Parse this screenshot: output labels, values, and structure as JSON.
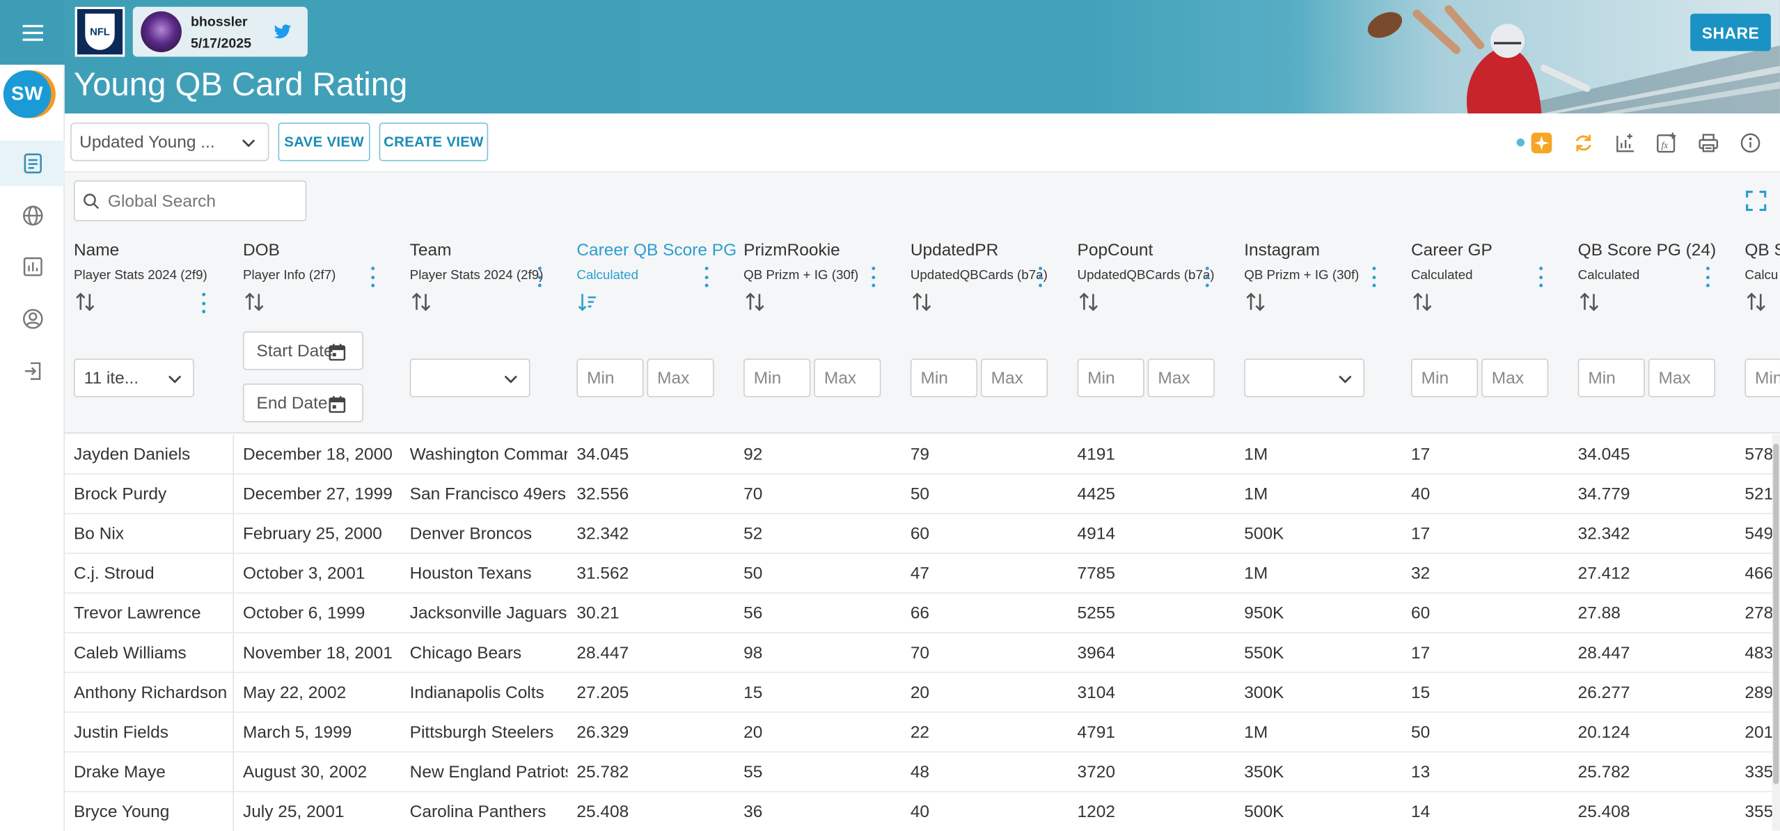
{
  "header": {
    "user_name": "bhossler",
    "user_date": "5/17/2025",
    "page_title": "Young QB Card Rating",
    "share_label": "SHARE",
    "brand_logo": "NFL",
    "app_logo": "SW"
  },
  "toolbar": {
    "view_select_value": "Updated Young ...",
    "save_view_label": "SAVE VIEW",
    "create_view_label": "CREATE VIEW",
    "icons": [
      "sparkle-icon",
      "refresh-icon",
      "add-chart-icon",
      "add-formula-icon",
      "print-icon",
      "info-icon"
    ]
  },
  "search": {
    "placeholder": "Global Search"
  },
  "nav": {
    "icons": [
      "menu-icon",
      "report-icon",
      "globe-icon",
      "bar-chart-icon",
      "user-icon",
      "login-icon"
    ]
  },
  "colors": {
    "header_teal": "#3f9fb7",
    "accent_blue": "#2b9ed0",
    "share_blue": "#1a93c4",
    "logo_orange": "#f59b23"
  },
  "columns": [
    {
      "title": "Name",
      "source": "Player Stats 2024 (2f9)"
    },
    {
      "title": "DOB",
      "source": "Player Info (2f7)"
    },
    {
      "title": "Team",
      "source": "Player Stats 2024 (2f9)"
    },
    {
      "title": "Career QB Score PG",
      "source": "Calculated"
    },
    {
      "title": "PrizmRookie",
      "source": "QB Prizm + IG (30f)"
    },
    {
      "title": "UpdatedPR",
      "source": "UpdatedQBCards (b7a)"
    },
    {
      "title": "PopCount",
      "source": "UpdatedQBCards (b7a)"
    },
    {
      "title": "Instagram",
      "source": "QB Prizm + IG (30f)"
    },
    {
      "title": "Career GP",
      "source": "Calculated"
    },
    {
      "title": "QB Score PG (24)",
      "source": "Calculated"
    },
    {
      "title": "QB S",
      "source": "Calcu"
    }
  ],
  "filters": {
    "name_select": "11 ite...",
    "start_date": "Start Date",
    "end_date": "End Date",
    "min": "Min",
    "max": "Max"
  },
  "rows": [
    [
      "Jayden Daniels",
      "December 18, 2000",
      "Washington Comman",
      "34.045",
      "92",
      "79",
      "4191",
      "1M",
      "17",
      "34.045",
      "578"
    ],
    [
      "Brock Purdy",
      "December 27, 1999",
      "San Francisco 49ers",
      "32.556",
      "70",
      "50",
      "4425",
      "1M",
      "40",
      "34.779",
      "521"
    ],
    [
      "Bo Nix",
      "February 25, 2000",
      "Denver Broncos",
      "32.342",
      "52",
      "60",
      "4914",
      "500K",
      "17",
      "32.342",
      "549"
    ],
    [
      "C.j. Stroud",
      "October 3, 2001",
      "Houston Texans",
      "31.562",
      "50",
      "47",
      "7785",
      "1M",
      "32",
      "27.412",
      "466"
    ],
    [
      "Trevor Lawrence",
      "October 6, 1999",
      "Jacksonville Jaguars",
      "30.21",
      "56",
      "66",
      "5255",
      "950K",
      "60",
      "27.88",
      "278"
    ],
    [
      "Caleb Williams",
      "November 18, 2001",
      "Chicago Bears",
      "28.447",
      "98",
      "70",
      "3964",
      "550K",
      "17",
      "28.447",
      "483"
    ],
    [
      "Anthony Richardson",
      "May 22, 2002",
      "Indianapolis Colts",
      "27.205",
      "15",
      "20",
      "3104",
      "300K",
      "15",
      "26.277",
      "289"
    ],
    [
      "Justin Fields",
      "March 5, 1999",
      "Pittsburgh Steelers",
      "26.329",
      "20",
      "22",
      "4791",
      "1M",
      "50",
      "20.124",
      "201"
    ],
    [
      "Drake Maye",
      "August 30, 2002",
      "New England Patriots",
      "25.782",
      "55",
      "48",
      "3720",
      "350K",
      "13",
      "25.782",
      "335"
    ],
    [
      "Bryce Young",
      "July 25, 2001",
      "Carolina Panthers",
      "25.408",
      "36",
      "40",
      "1202",
      "500K",
      "14",
      "25.408",
      "355"
    ]
  ]
}
